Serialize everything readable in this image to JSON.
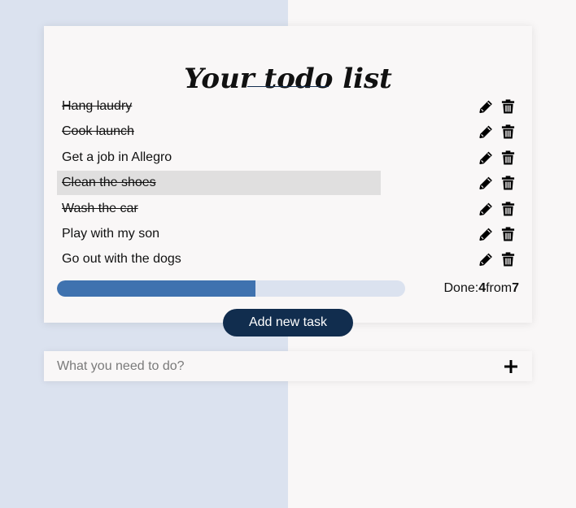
{
  "title": "Your todo list",
  "tasks": [
    {
      "label": "Hang laudry",
      "done": true,
      "highlighted": false
    },
    {
      "label": "Cook launch",
      "done": true,
      "highlighted": false
    },
    {
      "label": "Get a job in Allegro",
      "done": false,
      "highlighted": false
    },
    {
      "label": "Clean the shoes",
      "done": true,
      "highlighted": true
    },
    {
      "label": "Wash the car",
      "done": true,
      "highlighted": false
    },
    {
      "label": "Play with my son",
      "done": false,
      "highlighted": false
    },
    {
      "label": "Go out with the dogs",
      "done": false,
      "highlighted": false
    }
  ],
  "progress": {
    "done_label": "Done:",
    "done_count": "4",
    "from_label": "from",
    "total_count": "7",
    "fraction": 0.571
  },
  "add_button_label": "Add new task",
  "new_task_input": {
    "placeholder": "What you need to do?",
    "value": ""
  },
  "icons": {
    "edit": "pencil-icon",
    "delete": "trash-icon",
    "add": "plus-icon"
  },
  "colors": {
    "bg_left": "#dbe2ef",
    "bg_right": "#f9f7f7",
    "progress_fill": "#3f72af",
    "progress_track": "#dbe2ef",
    "button": "#112d4e",
    "highlight": "#e0dfdf"
  }
}
